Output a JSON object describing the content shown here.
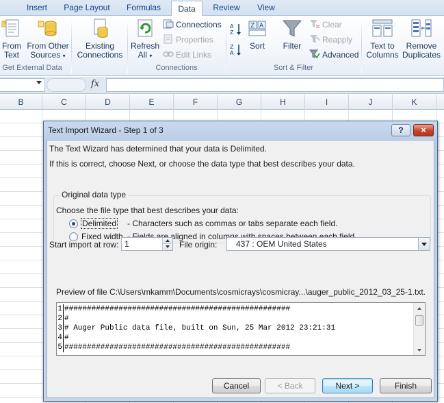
{
  "ribbon": {
    "tabs": [
      "Insert",
      "Page Layout",
      "Formulas",
      "Data",
      "Review",
      "View"
    ],
    "active_tab": "Data",
    "groups": {
      "get_external": {
        "label": "Get External Data",
        "from_text": [
          "From",
          "Text"
        ],
        "from_other": [
          "From Other",
          "Sources"
        ]
      },
      "existing_connections": [
        "Existing",
        "Connections"
      ],
      "connections": {
        "label": "Connections",
        "refresh_all": [
          "Refresh",
          "All"
        ],
        "connections": "Connections",
        "properties": "Properties",
        "edit_links": "Edit Links"
      },
      "sort_filter": {
        "label": "Sort & Filter",
        "sort": "Sort",
        "filter": "Filter",
        "clear": "Clear",
        "reapply": "Reapply",
        "advanced": "Advanced"
      },
      "data_tools": {
        "text_to_columns": [
          "Text to",
          "Columns"
        ],
        "remove_duplicates": [
          "Remove",
          "Duplicates"
        ]
      }
    }
  },
  "formula_bar": {
    "fx": "fx",
    "value": ""
  },
  "columns": [
    "B",
    "C",
    "D",
    "E",
    "F",
    "G",
    "H",
    "I",
    "J",
    "K"
  ],
  "dialog": {
    "title": "Text Import Wizard - Step 1 of 3",
    "help": "?",
    "close": "×",
    "intro1": "The Text Wizard has determined that your data is Delimited.",
    "intro2": "If this is correct, choose Next, or choose the data type that best describes your data.",
    "group_title": "Original data type",
    "choose_label": "Choose the file type that best describes your data:",
    "options": [
      {
        "label": "Delimited",
        "desc": "- Characters such as commas or tabs separate each field.",
        "checked": true
      },
      {
        "label": "Fixed width",
        "desc": "- Fields are aligned in columns with spaces between each field.",
        "checked": false
      }
    ],
    "start_row_label": "Start import at row:",
    "start_row_value": "1",
    "file_origin_label": "File origin:",
    "file_origin_value": "437 : OEM United States",
    "preview_label": "Preview of file C:\\Users\\mkamm\\Documents\\cosmicrays\\cosmicray...\\auger_public_2012_03_25-1.txt.",
    "preview_lines": [
      {
        "num": "1",
        "text": "##################################################"
      },
      {
        "num": "2",
        "text": "#"
      },
      {
        "num": "3",
        "text": "# Auger Public data file, built on Sun, 25 Mar 2012 23:21:31"
      },
      {
        "num": "4",
        "text": "#"
      },
      {
        "num": "5",
        "text": "##################################################"
      }
    ],
    "buttons": {
      "cancel": "Cancel",
      "back": "< Back",
      "next": "Next >",
      "finish": "Finish"
    }
  }
}
